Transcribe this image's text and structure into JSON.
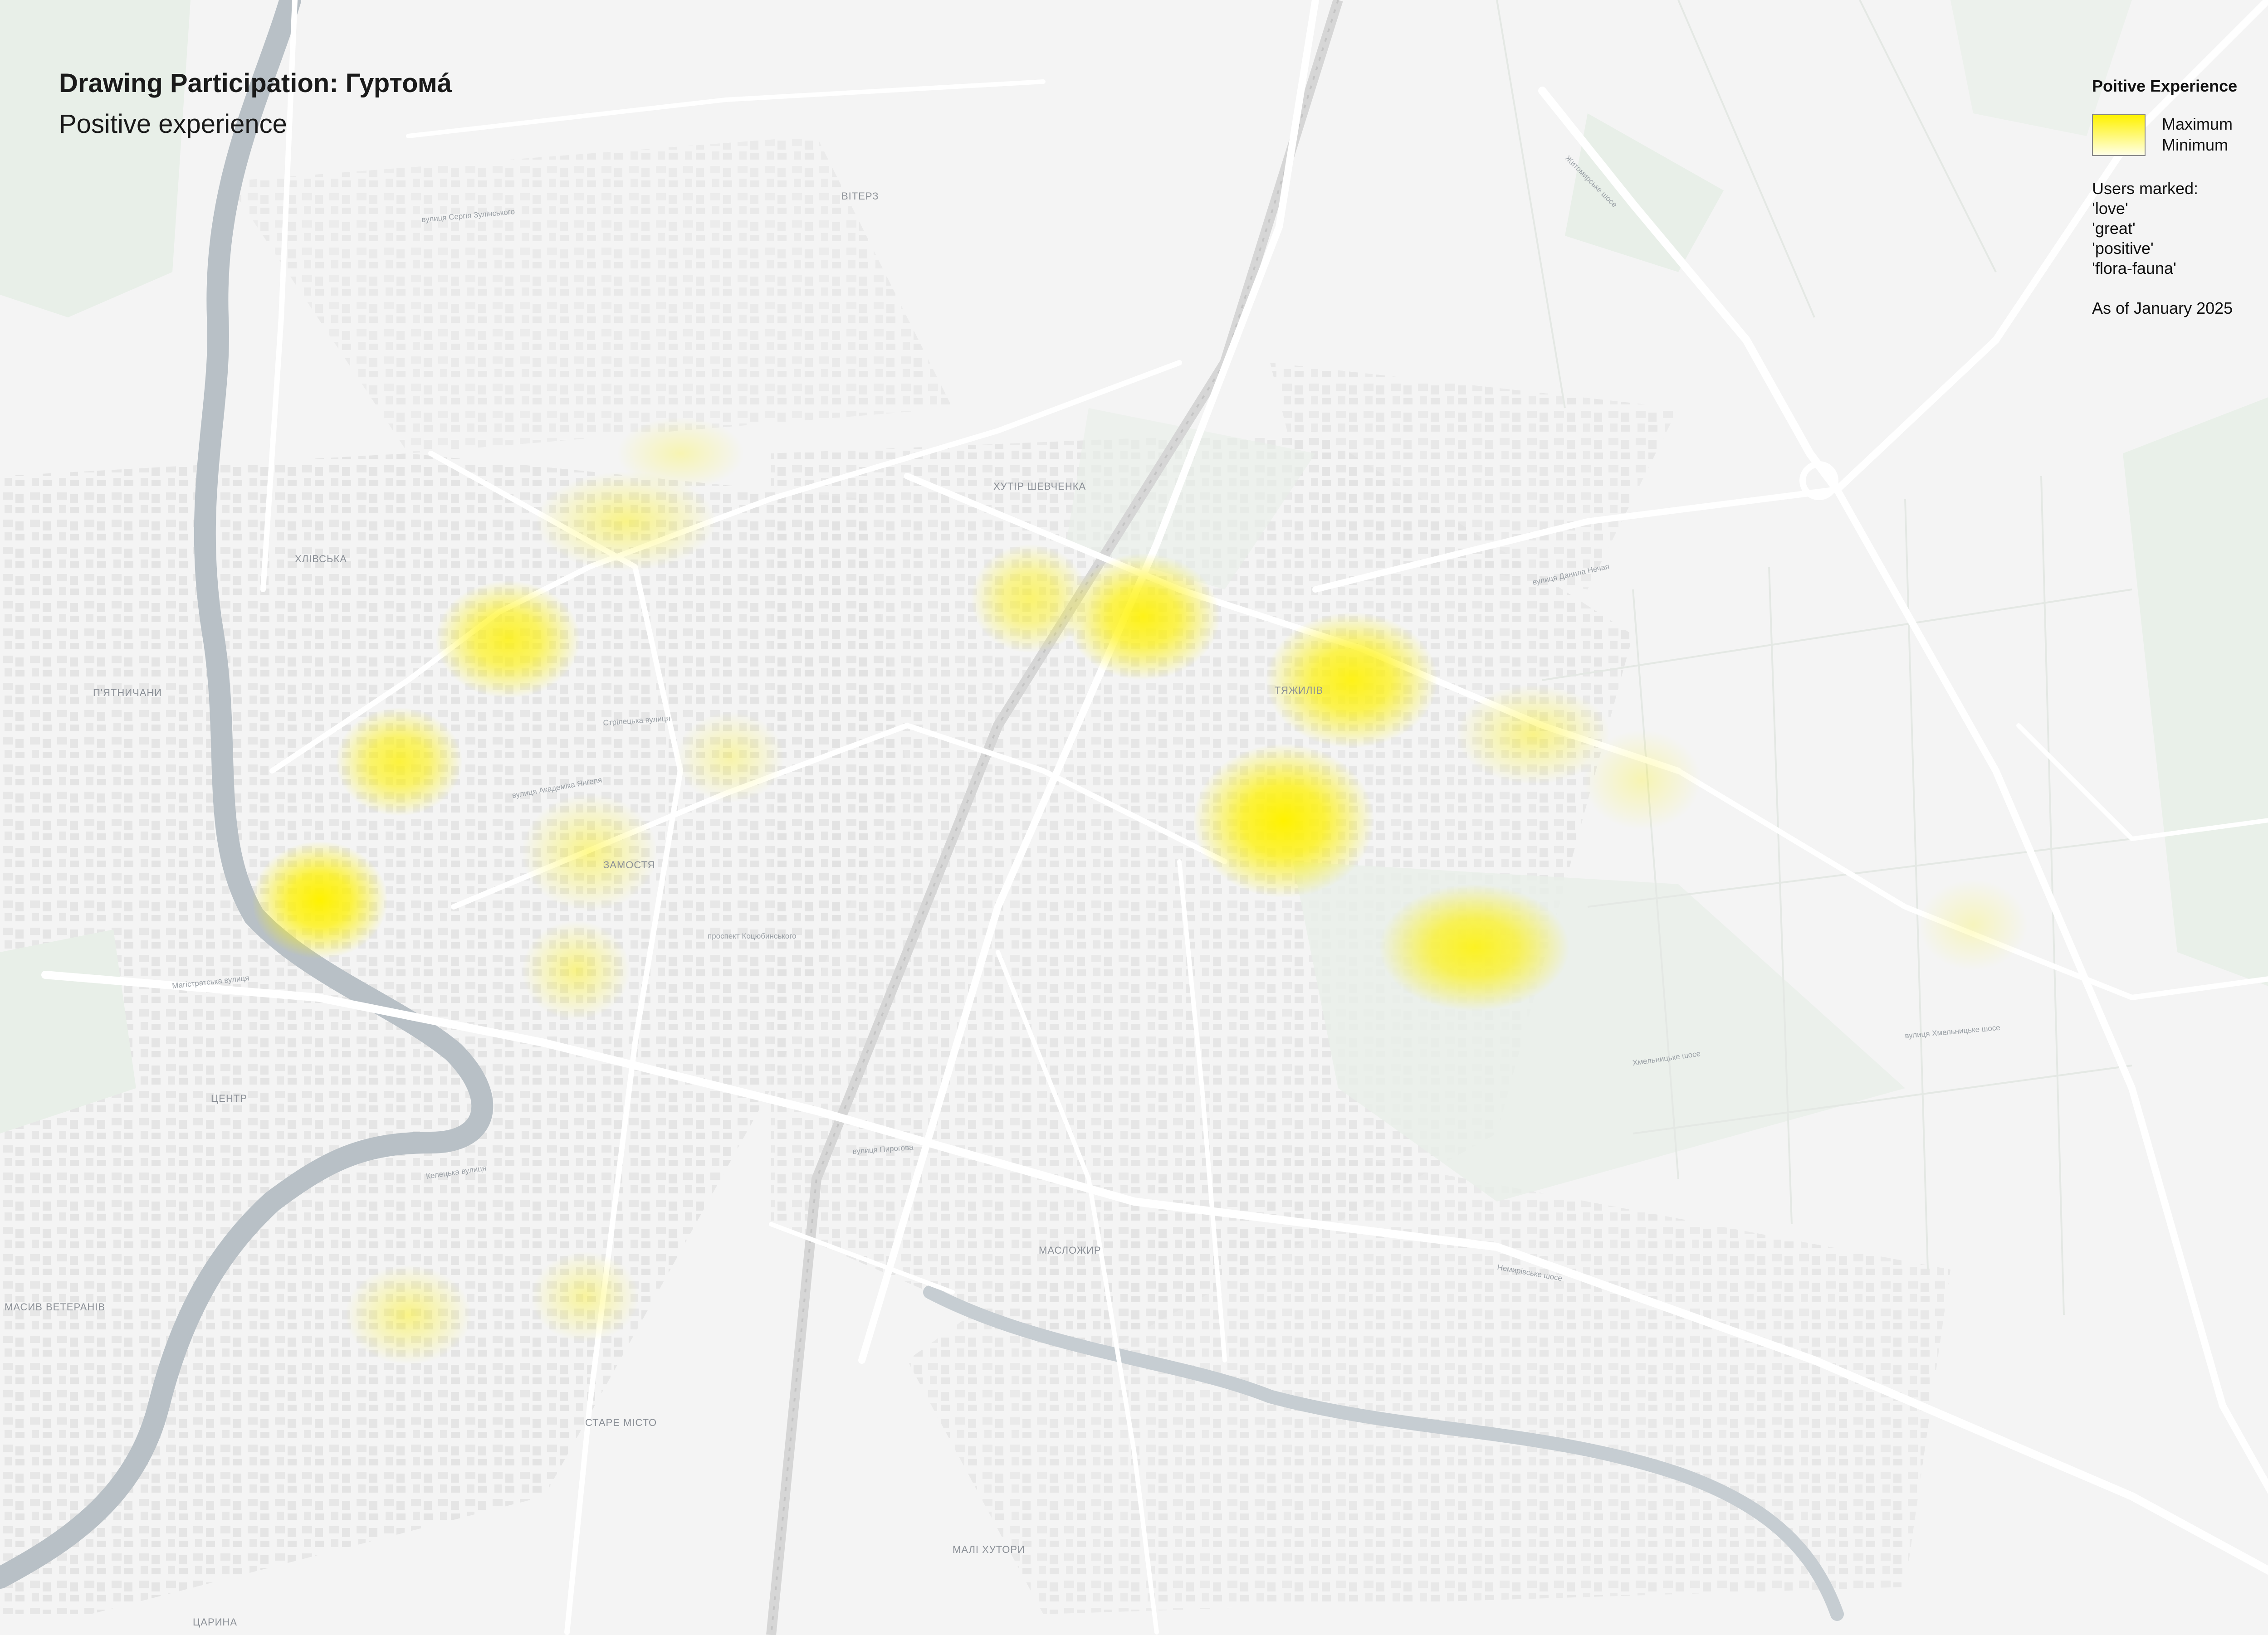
{
  "title": "Drawing Participation: Гуртомá",
  "subtitle": "Positive experience",
  "legend": {
    "title": "Poitive Experience",
    "max_label": "Maximum",
    "min_label": "Minimum",
    "gradient_top": "#fff200",
    "gradient_bottom": "#ffffe6",
    "users_heading": "Users marked:",
    "tags": [
      "'love'",
      "'great'",
      "'positive'",
      "'flora-fauna'"
    ],
    "as_of": "As of January 2025"
  },
  "colors": {
    "land": "#f4f4f4",
    "river": "#b8c0c6",
    "road": "#ffffff",
    "park": "#e8efe8",
    "heat": "#fff200"
  },
  "place_labels": [
    "ХЛІВСЬКА",
    "П'ЯТНИЧАНИ",
    "ЗАМОСТЯ",
    "ЦЕНТР",
    "МАСИВ ВЕТЕРАНІВ",
    "СТАРЕ МІСТО",
    "МАЛІ ХУТОРИ",
    "ЦАРИНА",
    "ВІТЕРЗ",
    "ХУТІР ШЕВЧЕНКА",
    "ТЯЖИЛІВ",
    "МАСЛОЖИР"
  ],
  "street_labels": [
    "вулиця Сергія Зулінського",
    "Стрілецька вулиця",
    "вулиця Академіка Янгеля",
    "проспект Коцюбинського",
    "вулиця Пирогова",
    "Хмельницьке шосе",
    "Немирівське шосе",
    "Житомирське шосе",
    "вулиця Данила Нечая",
    "вулиця Хмельницьке шосе",
    "Келецька вулиця",
    "Магістратська вулиця"
  ]
}
